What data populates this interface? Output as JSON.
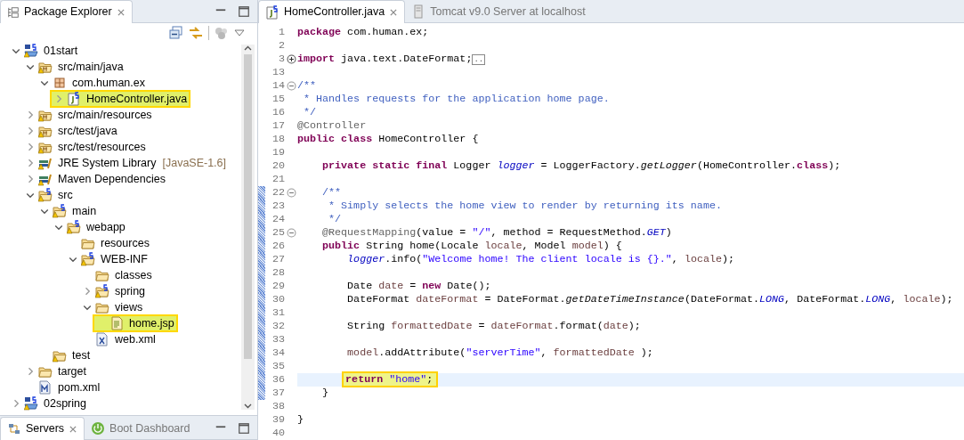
{
  "explorer": {
    "tabs": [
      {
        "label": "Package Explorer",
        "selected": true
      }
    ],
    "tree": [
      {
        "label": "01start",
        "kind": "project",
        "expanded": true,
        "highlighted": false,
        "children": [
          {
            "label": "src/main/java",
            "kind": "source-folder",
            "expanded": true,
            "highlighted": false,
            "children": [
              {
                "label": "com.human.ex",
                "kind": "package",
                "expanded": true,
                "highlighted": false,
                "children": [
                  {
                    "label": "HomeController.java",
                    "kind": "java-file",
                    "expanded": false,
                    "highlighted": true
                  }
                ]
              }
            ]
          },
          {
            "label": "src/main/resources",
            "kind": "source-folder",
            "expanded": false,
            "highlighted": false
          },
          {
            "label": "src/test/java",
            "kind": "source-folder",
            "expanded": false,
            "highlighted": false
          },
          {
            "label": "src/test/resources",
            "kind": "source-folder",
            "expanded": false,
            "highlighted": false
          },
          {
            "label": "JRE System Library",
            "decoration": "[JavaSE-1.6]",
            "kind": "library",
            "expanded": false,
            "highlighted": false
          },
          {
            "label": "Maven Dependencies",
            "kind": "library",
            "expanded": false,
            "highlighted": false
          },
          {
            "label": "src",
            "kind": "spring-folder",
            "expanded": true,
            "highlighted": false,
            "children": [
              {
                "label": "main",
                "kind": "spring-folder",
                "expanded": true,
                "highlighted": false,
                "children": [
                  {
                    "label": "webapp",
                    "kind": "spring-folder",
                    "expanded": true,
                    "highlighted": false,
                    "children": [
                      {
                        "label": "resources",
                        "kind": "folder",
                        "highlighted": false
                      },
                      {
                        "label": "WEB-INF",
                        "kind": "spring-folder",
                        "expanded": true,
                        "highlighted": false,
                        "children": [
                          {
                            "label": "classes",
                            "kind": "folder",
                            "highlighted": false
                          },
                          {
                            "label": "spring",
                            "kind": "spring-folder",
                            "expanded": false,
                            "highlighted": false
                          },
                          {
                            "label": "views",
                            "kind": "folder",
                            "expanded": true,
                            "highlighted": false,
                            "children": [
                              {
                                "label": "home.jsp",
                                "kind": "jsp-file",
                                "highlighted": true
                              }
                            ]
                          },
                          {
                            "label": "web.xml",
                            "kind": "xml-file",
                            "highlighted": false
                          }
                        ]
                      }
                    ]
                  }
                ]
              },
              {
                "label": "test",
                "kind": "warn-folder",
                "highlighted": false
              }
            ]
          },
          {
            "label": "target",
            "kind": "folder",
            "expanded": false,
            "highlighted": false
          },
          {
            "label": "pom.xml",
            "kind": "maven-file",
            "highlighted": false
          }
        ]
      },
      {
        "label": "02spring",
        "kind": "project",
        "expanded": false,
        "highlighted": false
      }
    ]
  },
  "bottom_panel": {
    "tabs": [
      {
        "label": "Servers",
        "kind": "servers",
        "selected": true
      },
      {
        "label": "Boot Dashboard",
        "kind": "boot",
        "selected": false
      }
    ]
  },
  "editor": {
    "tabs": [
      {
        "label": "HomeController.java",
        "kind": "java-file",
        "selected": true
      },
      {
        "label": "Tomcat v9.0 Server at localhost",
        "kind": "server",
        "selected": false
      }
    ],
    "lines": [
      {
        "number": "1",
        "changed": false,
        "current": false,
        "highlighted": false,
        "tokens": [
          {
            "kind": "keyword",
            "text": "package"
          },
          {
            "kind": "plain",
            "text": " com.human.ex;"
          }
        ]
      },
      {
        "number": "2",
        "changed": false,
        "current": false,
        "highlighted": false
      },
      {
        "number": "3",
        "collapsed": true,
        "changed": false,
        "current": false,
        "highlighted": false,
        "tokens": [
          {
            "kind": "keyword",
            "text": "import"
          },
          {
            "kind": "plain",
            "text": " java.text.DateFormat;"
          },
          {
            "kind": "folded",
            "text": ".."
          }
        ]
      },
      {
        "number": "13",
        "changed": false,
        "current": false,
        "highlighted": false
      },
      {
        "number": "14",
        "collapsed": false,
        "changed": false,
        "current": false,
        "highlighted": false,
        "tokens": [
          {
            "kind": "comment",
            "text": "/**"
          }
        ]
      },
      {
        "number": "15",
        "changed": false,
        "current": false,
        "highlighted": false,
        "tokens": [
          {
            "kind": "comment",
            "text": " * Handles requests for the application home page."
          }
        ]
      },
      {
        "number": "16",
        "changed": false,
        "current": false,
        "highlighted": false,
        "tokens": [
          {
            "kind": "comment",
            "text": " */"
          }
        ]
      },
      {
        "number": "17",
        "changed": false,
        "current": false,
        "highlighted": false,
        "tokens": [
          {
            "kind": "annotation",
            "text": "@Controller"
          }
        ]
      },
      {
        "number": "18",
        "changed": false,
        "current": false,
        "highlighted": false,
        "tokens": [
          {
            "kind": "keyword",
            "text": "public class"
          },
          {
            "kind": "plain",
            "text": " HomeController {"
          }
        ]
      },
      {
        "number": "19",
        "changed": false,
        "current": false,
        "highlighted": false
      },
      {
        "number": "20",
        "changed": false,
        "current": false,
        "highlighted": false,
        "tokens": [
          {
            "kind": "keyword",
            "text": "    private static final"
          },
          {
            "kind": "plain",
            "text": " Logger "
          },
          {
            "kind": "field",
            "text": "logger"
          },
          {
            "kind": "plain",
            "text": " = LoggerFactory."
          },
          {
            "kind": "static-method",
            "text": "getLogger"
          },
          {
            "kind": "plain",
            "text": "(HomeController."
          },
          {
            "kind": "keyword",
            "text": "class"
          },
          {
            "kind": "plain",
            "text": ");"
          }
        ]
      },
      {
        "number": "21",
        "changed": false,
        "current": false,
        "highlighted": false
      },
      {
        "number": "22",
        "collapsed": false,
        "changed": true,
        "current": false,
        "highlighted": false,
        "tokens": [
          {
            "kind": "comment",
            "text": "    /**"
          }
        ]
      },
      {
        "number": "23",
        "changed": true,
        "current": false,
        "highlighted": false,
        "tokens": [
          {
            "kind": "comment",
            "text": "     * Simply selects the home view to render by returning its name."
          }
        ]
      },
      {
        "number": "24",
        "changed": true,
        "current": false,
        "highlighted": false,
        "tokens": [
          {
            "kind": "comment",
            "text": "     */"
          }
        ]
      },
      {
        "number": "25",
        "collapsed": false,
        "changed": true,
        "current": false,
        "highlighted": false,
        "tokens": [
          {
            "kind": "annotation",
            "text": "    @RequestMapping"
          },
          {
            "kind": "plain",
            "text": "(value = "
          },
          {
            "kind": "string",
            "text": "\"/\""
          },
          {
            "kind": "plain",
            "text": ", method = RequestMethod."
          },
          {
            "kind": "field",
            "text": "GET"
          },
          {
            "kind": "plain",
            "text": ")"
          }
        ]
      },
      {
        "number": "26",
        "changed": true,
        "current": false,
        "highlighted": false,
        "tokens": [
          {
            "kind": "keyword",
            "text": "    public"
          },
          {
            "kind": "plain",
            "text": " String home(Locale "
          },
          {
            "kind": "local",
            "text": "locale"
          },
          {
            "kind": "plain",
            "text": ", Model "
          },
          {
            "kind": "local",
            "text": "model"
          },
          {
            "kind": "plain",
            "text": ") {"
          }
        ]
      },
      {
        "number": "27",
        "changed": true,
        "current": false,
        "highlighted": false,
        "tokens": [
          {
            "kind": "field",
            "text": "        logger"
          },
          {
            "kind": "plain",
            "text": ".info("
          },
          {
            "kind": "string",
            "text": "\"Welcome home! The client locale is {}.\""
          },
          {
            "kind": "plain",
            "text": ", "
          },
          {
            "kind": "local",
            "text": "locale"
          },
          {
            "kind": "plain",
            "text": ");"
          }
        ]
      },
      {
        "number": "28",
        "changed": true,
        "current": false,
        "highlighted": false
      },
      {
        "number": "29",
        "changed": true,
        "current": false,
        "highlighted": false,
        "tokens": [
          {
            "kind": "plain",
            "text": "        Date "
          },
          {
            "kind": "local",
            "text": "date"
          },
          {
            "kind": "plain",
            "text": " = "
          },
          {
            "kind": "keyword",
            "text": "new"
          },
          {
            "kind": "plain",
            "text": " Date();"
          }
        ]
      },
      {
        "number": "30",
        "changed": true,
        "current": false,
        "highlighted": false,
        "tokens": [
          {
            "kind": "plain",
            "text": "        DateFormat "
          },
          {
            "kind": "local",
            "text": "dateFormat"
          },
          {
            "kind": "plain",
            "text": " = DateFormat."
          },
          {
            "kind": "static-method",
            "text": "getDateTimeInstance"
          },
          {
            "kind": "plain",
            "text": "(DateFormat."
          },
          {
            "kind": "field",
            "text": "LONG"
          },
          {
            "kind": "plain",
            "text": ", DateFormat."
          },
          {
            "kind": "field",
            "text": "LONG"
          },
          {
            "kind": "plain",
            "text": ", "
          },
          {
            "kind": "local",
            "text": "locale"
          },
          {
            "kind": "plain",
            "text": ");"
          }
        ]
      },
      {
        "number": "31",
        "changed": true,
        "current": false,
        "highlighted": false
      },
      {
        "number": "32",
        "changed": true,
        "current": false,
        "highlighted": false,
        "tokens": [
          {
            "kind": "plain",
            "text": "        String "
          },
          {
            "kind": "local",
            "text": "formattedDate"
          },
          {
            "kind": "plain",
            "text": " = "
          },
          {
            "kind": "local",
            "text": "dateFormat"
          },
          {
            "kind": "plain",
            "text": ".format("
          },
          {
            "kind": "local",
            "text": "date"
          },
          {
            "kind": "plain",
            "text": ");"
          }
        ]
      },
      {
        "number": "33",
        "changed": true,
        "current": false,
        "highlighted": false
      },
      {
        "number": "34",
        "changed": true,
        "current": false,
        "highlighted": false,
        "tokens": [
          {
            "kind": "local",
            "text": "        model"
          },
          {
            "kind": "plain",
            "text": ".addAttribute("
          },
          {
            "kind": "string",
            "text": "\"serverTime\""
          },
          {
            "kind": "plain",
            "text": ", "
          },
          {
            "kind": "local",
            "text": "formattedDate"
          },
          {
            "kind": "plain",
            "text": " );"
          }
        ]
      },
      {
        "number": "35",
        "changed": true,
        "current": false,
        "highlighted": false
      },
      {
        "number": "36",
        "changed": true,
        "current": true,
        "highlighted": true,
        "tokens": [
          {
            "kind": "keyword",
            "text": "        return "
          },
          {
            "kind": "string",
            "text": "\"home\""
          },
          {
            "kind": "plain",
            "text": ";"
          }
        ]
      },
      {
        "number": "37",
        "changed": true,
        "current": false,
        "highlighted": false,
        "tokens": [
          {
            "kind": "plain",
            "text": "    }"
          }
        ]
      },
      {
        "number": "38",
        "changed": false,
        "current": false,
        "highlighted": false
      },
      {
        "number": "39",
        "changed": false,
        "current": false,
        "highlighted": false,
        "tokens": [
          {
            "kind": "plain",
            "text": "}"
          }
        ]
      },
      {
        "number": "40",
        "changed": false,
        "current": false,
        "highlighted": false
      }
    ]
  }
}
